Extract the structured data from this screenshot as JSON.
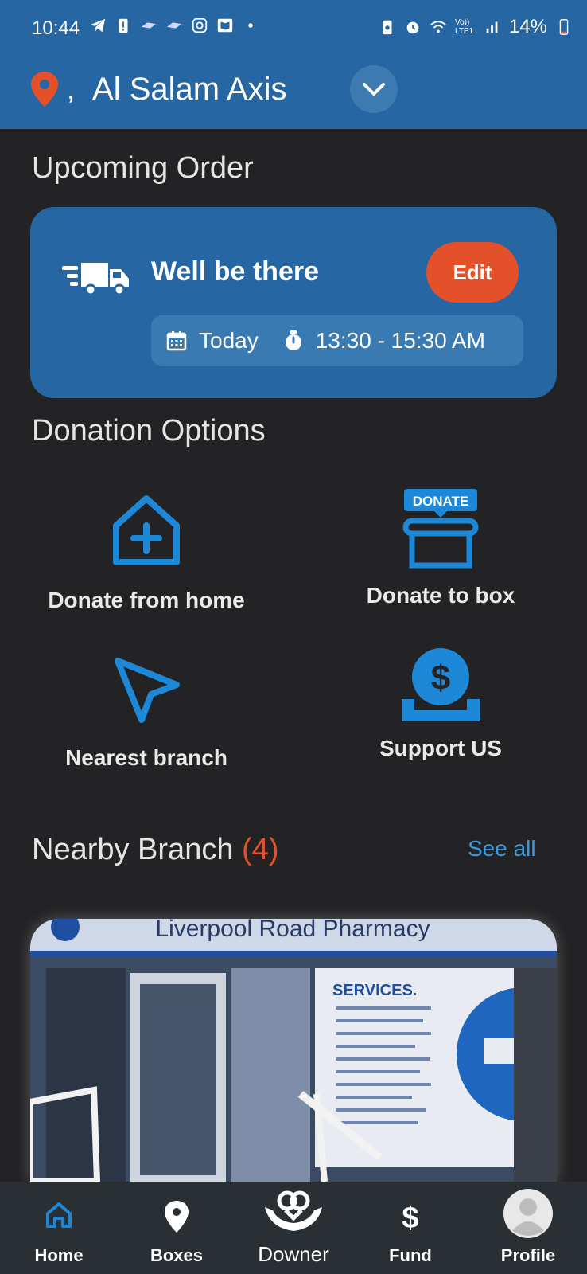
{
  "status_bar": {
    "time": "10:44",
    "battery": "14%",
    "network": "Vo)) LTE1"
  },
  "location": {
    "separator": ",",
    "name": "Al Salam Axis"
  },
  "upcoming": {
    "section_title": "Upcoming Order",
    "status_text": "Well be there",
    "edit_label": "Edit",
    "day": "Today",
    "time_window": "13:30 - 15:30 AM"
  },
  "donation": {
    "section_title": "Donation Options",
    "options": [
      {
        "label": "Donate from home",
        "icon": "home-plus-icon"
      },
      {
        "label": "Donate to box",
        "icon": "donate-box-icon",
        "badge": "DONATE"
      },
      {
        "label": "Nearest branch",
        "icon": "navigation-arrow-icon"
      },
      {
        "label": "Support US",
        "icon": "dollar-coin-icon"
      }
    ]
  },
  "nearby": {
    "title": "Nearby Branch",
    "count": "(4)",
    "see_all": "See all",
    "photo_sign": "Liverpool Road Pharmacy",
    "photo_services": "SERVICES."
  },
  "nav": {
    "items": [
      {
        "label": "Home",
        "icon": "home-icon",
        "active": true
      },
      {
        "label": "Boxes",
        "icon": "location-pin-icon"
      },
      {
        "label": "Downer",
        "icon": "hands-heart-icon"
      },
      {
        "label": "Fund",
        "icon": "dollar-icon"
      },
      {
        "label": "Profile",
        "icon": "avatar-icon"
      }
    ]
  },
  "colors": {
    "header": "#2566a3",
    "background": "#232325",
    "accent_orange": "#e4502a",
    "icon_blue": "#1e88d8",
    "link_blue": "#3a9be0"
  }
}
